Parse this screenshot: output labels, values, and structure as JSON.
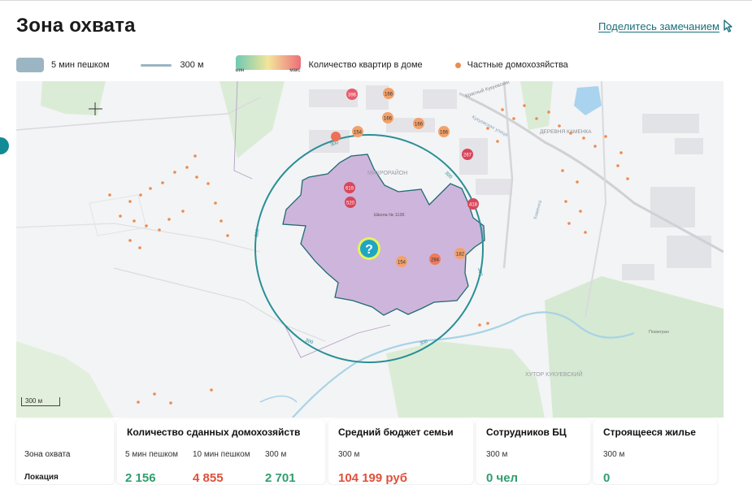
{
  "header": {
    "title": "Зона охвата",
    "share_link": "Поделитесь замечанием"
  },
  "legend": {
    "walk5": "5 мин пешком",
    "radius300": "300 м",
    "gradient_label": "Количество квартир в доме",
    "gradient_min": "мин",
    "gradient_max": "макс",
    "private": "Частные домохозяйства"
  },
  "map": {
    "scale_label": "300 м",
    "circle_label": "300",
    "center_icon": "question-icon",
    "pins": [
      {
        "label": "396",
        "color": "#e85a6b"
      },
      {
        "label": "166",
        "color": "#f3a16b"
      },
      {
        "label": "166",
        "color": "#f3a16b"
      },
      {
        "label": "166",
        "color": "#f3a16b"
      },
      {
        "label": "166",
        "color": "#f3a16b"
      },
      {
        "label": "154",
        "color": "#f3a16b"
      },
      {
        "label": "",
        "color": "#ee6e56"
      },
      {
        "label": "267",
        "color": "#d9455a"
      },
      {
        "label": "619",
        "color": "#d9455a"
      },
      {
        "label": "520",
        "color": "#d9455a"
      },
      {
        "label": "418",
        "color": "#d9455a"
      },
      {
        "label": "154",
        "color": "#f3a16b"
      },
      {
        "label": "284",
        "color": "#ee7a5a"
      },
      {
        "label": "182",
        "color": "#f3a16b"
      }
    ],
    "place_labels": {
      "krasny_kukuevsky": "Красный Кукуевский",
      "kukuevskaya_st": "Кукуевская улица",
      "derevnya_kamenka": "ДЕРЕВНЯ КАМЕНКА",
      "mikrorayon": "МИКРОРАЙОН",
      "school": "Школа № 1136",
      "khutor": "ХУТОР КУКУЕВСКИЙ",
      "kamenka": "Каменка",
      "pomegran": "Помегран"
    }
  },
  "colors": {
    "accent": "#138a94",
    "zone_fill": "#c7a9d6",
    "zone_stroke": "#1f6b74",
    "circle": "#2a8f96"
  },
  "cards": {
    "labels": {
      "zone": "Зона охвата",
      "location": "Локация"
    },
    "households": {
      "title": "Количество сданных домохозяйств",
      "cols": [
        "5 мин пешком",
        "10 мин пешком",
        "300 м"
      ],
      "values": [
        "2 156",
        "4 855",
        "2 701"
      ]
    },
    "budget": {
      "title": "Средний бюджет семьи",
      "sub": "300 м",
      "value": "104 199 руб"
    },
    "employees": {
      "title": "Сотрудников БЦ",
      "sub": "300 м",
      "value": "0 чел"
    },
    "construction": {
      "title": "Строящееся жилье",
      "sub": "300 м",
      "value": "0"
    }
  }
}
